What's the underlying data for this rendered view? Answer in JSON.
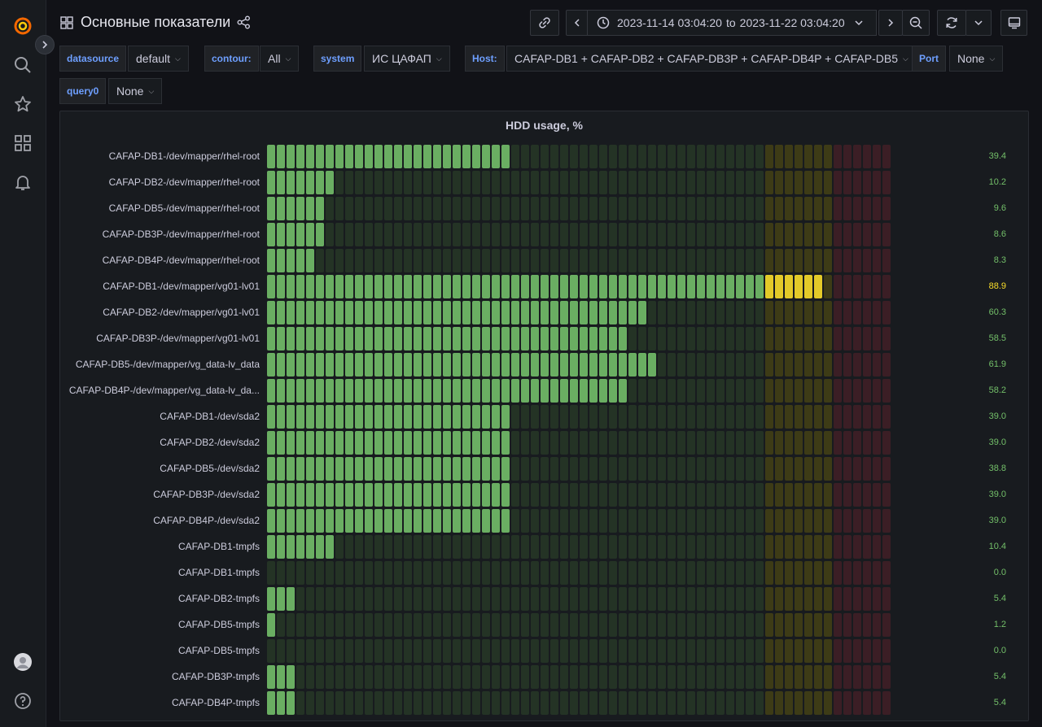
{
  "header": {
    "title": "Основные показатели",
    "time_from": "2023-11-14 03:04:20",
    "time_sep": "to",
    "time_to": "2023-11-22 03:04:20"
  },
  "variables": [
    {
      "label": "datasource",
      "value": "default"
    },
    {
      "label": "contour:",
      "value": "All"
    },
    {
      "label": "system",
      "value": "ИС ЦАФАП"
    },
    {
      "label": "Host:",
      "value": "CAFAP-DB1 + CAFAP-DB2 + CAFAP-DB3P + CAFAP-DB4P + CAFAP-DB5"
    },
    {
      "label": "Port",
      "value": "None"
    },
    {
      "label": "query0",
      "value": "None"
    }
  ],
  "panel": {
    "title": "HDD usage, %",
    "max": 100,
    "thresholds": {
      "yellow": 80,
      "red": 90
    },
    "colors": {
      "green": "#73bf69",
      "yellow": "#fade2a",
      "red": "#f2495c",
      "green_dim": "#243325",
      "yellow_dim": "#3d3b16",
      "red_dim": "#3b1e25"
    },
    "rows": [
      {
        "label": "CAFAP-DB1-/dev/mapper/rhel-root",
        "value": 39.4,
        "display": "39.4"
      },
      {
        "label": "CAFAP-DB2-/dev/mapper/rhel-root",
        "value": 10.2,
        "display": "10.2"
      },
      {
        "label": "CAFAP-DB5-/dev/mapper/rhel-root",
        "value": 9.6,
        "display": "9.6"
      },
      {
        "label": "CAFAP-DB3P-/dev/mapper/rhel-root",
        "value": 8.6,
        "display": "8.6"
      },
      {
        "label": "CAFAP-DB4P-/dev/mapper/rhel-root",
        "value": 8.3,
        "display": "8.3"
      },
      {
        "label": "CAFAP-DB1-/dev/mapper/vg01-lv01",
        "value": 88.9,
        "display": "88.9"
      },
      {
        "label": "CAFAP-DB2-/dev/mapper/vg01-lv01",
        "value": 60.3,
        "display": "60.3"
      },
      {
        "label": "CAFAP-DB3P-/dev/mapper/vg01-lv01",
        "value": 58.5,
        "display": "58.5"
      },
      {
        "label": "CAFAP-DB5-/dev/mapper/vg_data-lv_data",
        "value": 61.9,
        "display": "61.9"
      },
      {
        "label": "CAFAP-DB4P-/dev/mapper/vg_data-lv_da...",
        "value": 58.2,
        "display": "58.2"
      },
      {
        "label": "CAFAP-DB1-/dev/sda2",
        "value": 39.0,
        "display": "39.0"
      },
      {
        "label": "CAFAP-DB2-/dev/sda2",
        "value": 39.0,
        "display": "39.0"
      },
      {
        "label": "CAFAP-DB5-/dev/sda2",
        "value": 38.8,
        "display": "38.8"
      },
      {
        "label": "CAFAP-DB3P-/dev/sda2",
        "value": 39.0,
        "display": "39.0"
      },
      {
        "label": "CAFAP-DB4P-/dev/sda2",
        "value": 39.0,
        "display": "39.0"
      },
      {
        "label": "CAFAP-DB1-tmpfs",
        "value": 10.4,
        "display": "10.4"
      },
      {
        "label": "CAFAP-DB1-tmpfs",
        "value": 0.0,
        "display": "0.0"
      },
      {
        "label": "CAFAP-DB2-tmpfs",
        "value": 5.4,
        "display": "5.4"
      },
      {
        "label": "CAFAP-DB5-tmpfs",
        "value": 1.2,
        "display": "1.2"
      },
      {
        "label": "CAFAP-DB5-tmpfs",
        "value": 0.0,
        "display": "0.0"
      },
      {
        "label": "CAFAP-DB3P-tmpfs",
        "value": 5.4,
        "display": "5.4"
      },
      {
        "label": "CAFAP-DB4P-tmpfs",
        "value": 5.4,
        "display": "5.4"
      }
    ]
  }
}
